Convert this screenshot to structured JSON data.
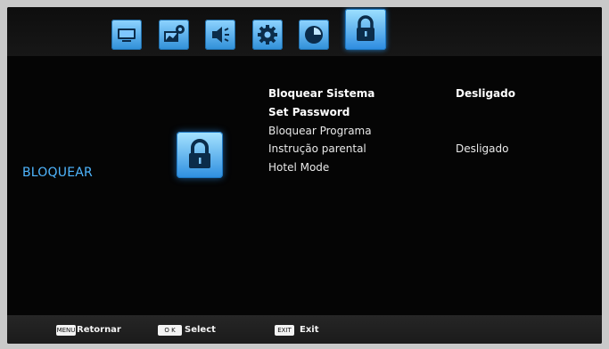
{
  "tabs": [
    {
      "icon": "tv-screen-icon",
      "label": ""
    },
    {
      "icon": "picture-settings-icon",
      "label": ""
    },
    {
      "icon": "speaker-icon",
      "label": ""
    },
    {
      "icon": "gear-icon",
      "label": ""
    },
    {
      "icon": "clock-icon",
      "label": ""
    },
    {
      "icon": "lock-icon",
      "label": ""
    }
  ],
  "active_tab": 5,
  "section": {
    "title": "BLOQUEAR",
    "icon": "lock-icon"
  },
  "menu": [
    {
      "label": "Bloquear Sistema",
      "value": "Desligado",
      "emphasis": true
    },
    {
      "label": "Set Password",
      "value": "",
      "emphasis": true
    },
    {
      "label": "Bloquear Programa",
      "value": "",
      "emphasis": false
    },
    {
      "label": "Instrução parental",
      "value": "Desligado",
      "emphasis": false
    },
    {
      "label": "Hotel Mode",
      "value": "",
      "emphasis": false
    }
  ],
  "hints": [
    {
      "key": "MENU",
      "label": "Retornar"
    },
    {
      "key": "O K",
      "label": "Select"
    },
    {
      "key": "EXIT",
      "label": "Exit"
    }
  ],
  "colors": {
    "accent": "#2f8fd8",
    "section_title": "#4fb6ff",
    "background": "#050505"
  }
}
